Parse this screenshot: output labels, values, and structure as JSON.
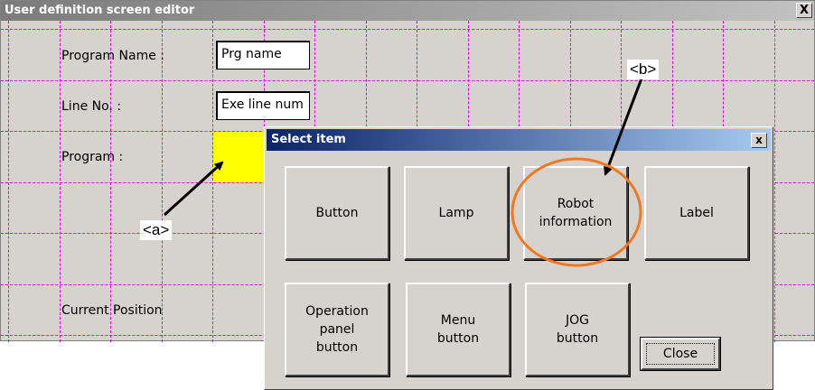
{
  "editor": {
    "title": "User definition screen editor",
    "close_glyph": "X",
    "fields": [
      {
        "label": "Program Name :",
        "value": "Prg name"
      },
      {
        "label": "Line No. :",
        "value": "Exe line num"
      },
      {
        "label": "Program :"
      },
      {
        "label": "Current Position"
      }
    ]
  },
  "dialog": {
    "title": "Select item",
    "close_glyph": "x",
    "items": [
      "Button",
      "Lamp",
      "Robot\ninformation",
      "Label",
      "Operation\npanel\nbutton",
      "Menu\nbutton",
      "JOG\nbutton"
    ],
    "close_button": "Close"
  },
  "annotations": {
    "a": "<a>",
    "b": "<b>"
  },
  "colors": {
    "grid": "#e000e0",
    "highlight_box": "#ffff00",
    "circle": "#f07820",
    "dialog_title_start": "#0a246a",
    "dialog_title_end": "#a6caf0"
  }
}
